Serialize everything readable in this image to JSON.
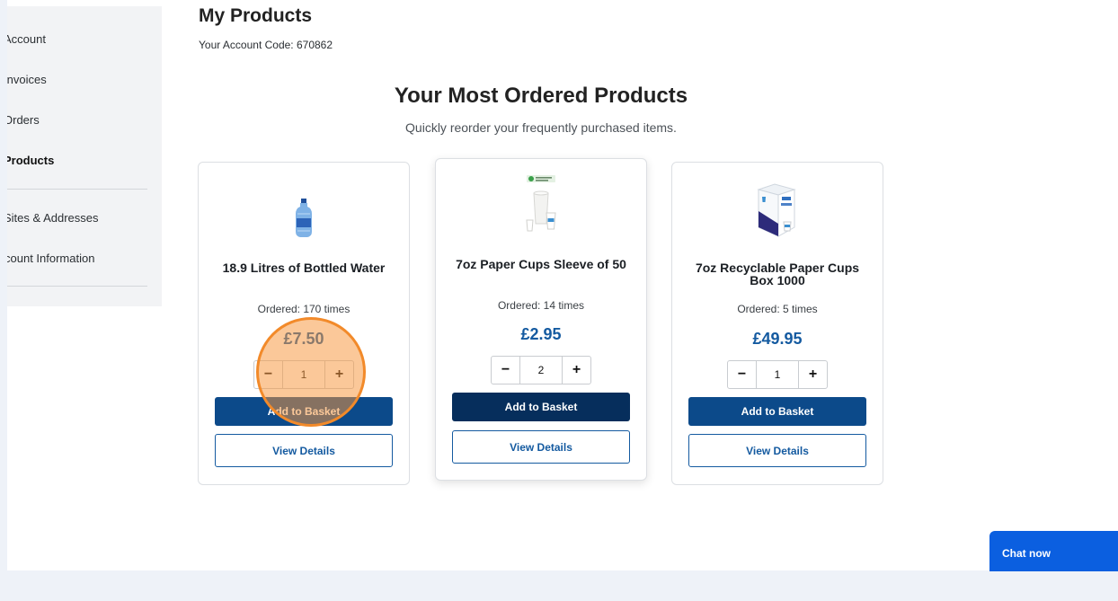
{
  "sidebar": {
    "items": [
      {
        "label": "Account"
      },
      {
        "label": "Invoices"
      },
      {
        "label": "Orders"
      },
      {
        "label": "Products"
      },
      {
        "label": "Sites & Addresses"
      },
      {
        "label": "count Information"
      }
    ]
  },
  "header": {
    "title": "My Products",
    "account_code": "Your Account Code: 670862"
  },
  "section": {
    "title": "Your Most Ordered Products",
    "subtitle": "Quickly reorder your frequently purchased items."
  },
  "products": [
    {
      "name": "18.9 Litres of Bottled Water",
      "ordered": "Ordered: 170 times",
      "price": "£7.50",
      "quantity": "1",
      "add_label": "Add to Basket",
      "view_label": "View Details",
      "image_icon": "water-bottle-icon"
    },
    {
      "name": "7oz Paper Cups Sleeve of 50",
      "ordered": "Ordered: 14 times",
      "price": "£2.95",
      "quantity": "2",
      "add_label": "Add to Basket",
      "view_label": "View Details",
      "image_icon": "paper-cups-icon"
    },
    {
      "name": "7oz Recyclable Paper Cups Box 1000",
      "ordered": "Ordered: 5 times",
      "price": "£49.95",
      "quantity": "1",
      "add_label": "Add to Basket",
      "view_label": "View Details",
      "image_icon": "cup-box-icon"
    }
  ],
  "stepper": {
    "minus": "−",
    "plus": "+"
  },
  "chat": {
    "label": "Chat now"
  },
  "colors": {
    "primary": "#0c4a8a",
    "price": "#145aa0",
    "chat": "#0b5fe0",
    "highlight": "#f28a2a"
  }
}
